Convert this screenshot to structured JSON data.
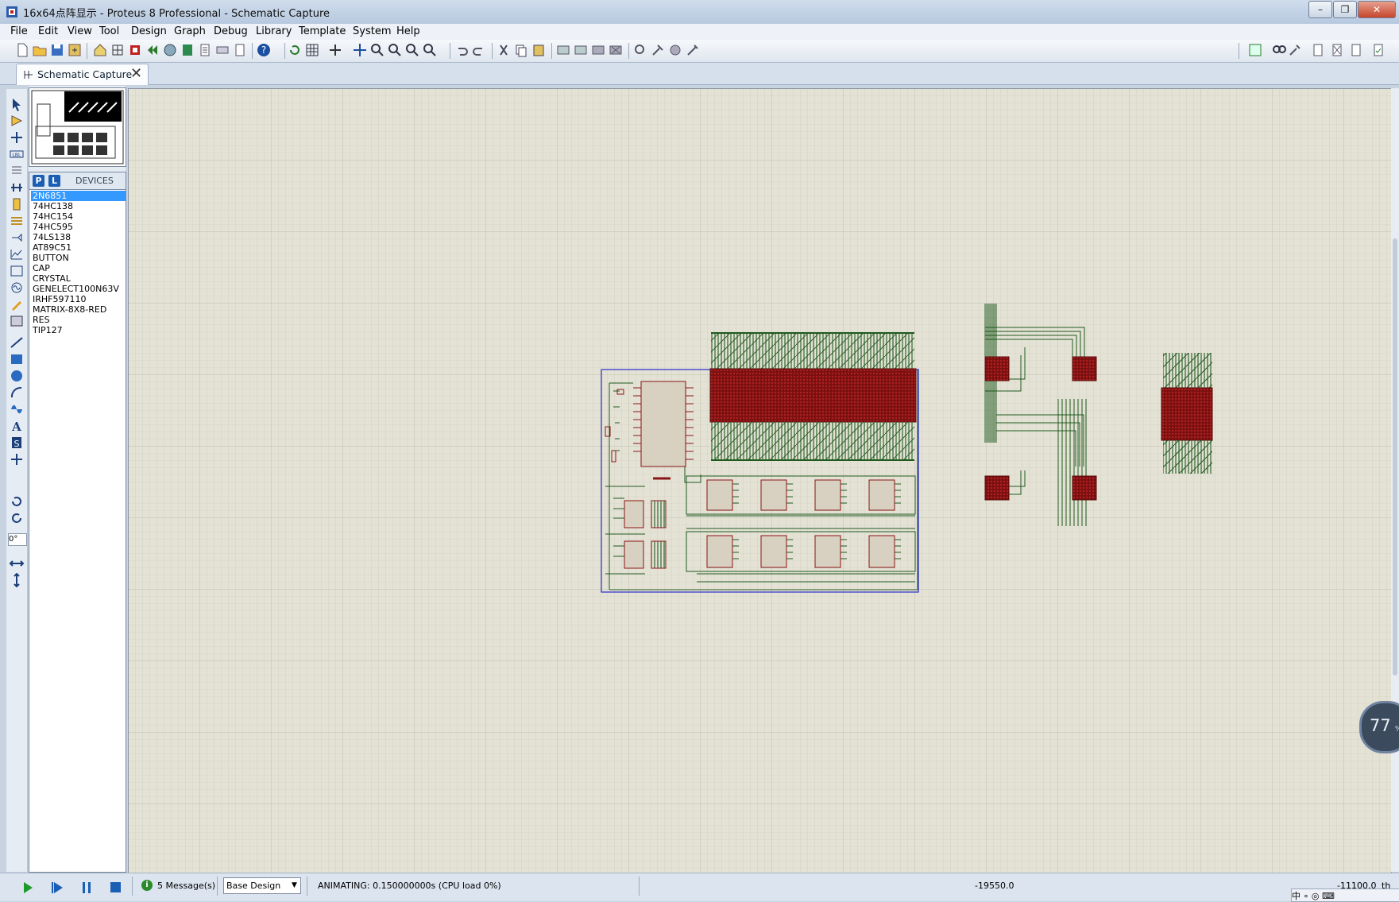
{
  "window": {
    "title": "16x64点阵显示 - Proteus 8 Professional - Schematic Capture",
    "controls": [
      "–",
      "❐",
      "✕"
    ]
  },
  "menu": [
    "File",
    "Edit",
    "View",
    "Tool",
    "Design",
    "Graph",
    "Debug",
    "Library",
    "Template",
    "System",
    "Help"
  ],
  "tab": {
    "label": "Schematic Capture",
    "close": "✕"
  },
  "devices_panel": {
    "p_button": "P",
    "l_button": "L",
    "title": "DEVICES",
    "items": [
      "2N6851",
      "74HC138",
      "74HC154",
      "74HC595",
      "74LS138",
      "AT89C51",
      "BUTTON",
      "CAP",
      "CRYSTAL",
      "GENELECT100N63V",
      "IRHF597110",
      "MATRIX-8X8-RED",
      "RES",
      "TIP127"
    ],
    "selected_index": 0
  },
  "rotation": "0°",
  "status": {
    "messages": "5 Message(s)",
    "message_icon": "i",
    "variant": "Base Design",
    "animation": "ANIMATING: 0.150000000s (CPU load 0%)",
    "coord_x": "-19550.0",
    "coord_y": "-11100.0",
    "coord_unit": "th"
  },
  "overlay_widget": {
    "percent": "77",
    "unit": "%"
  },
  "ime_bar": "中 ∘ ◎ ⌨",
  "colors": {
    "canvas_bg": "#e4e2d5",
    "grid": "#c9c8b9",
    "wire": "#1f5a1f",
    "led_matrix": "#7a1010",
    "component_fill": "#d8d0c0",
    "component_border": "#8a1515",
    "selection_box": "#2a2acc"
  }
}
